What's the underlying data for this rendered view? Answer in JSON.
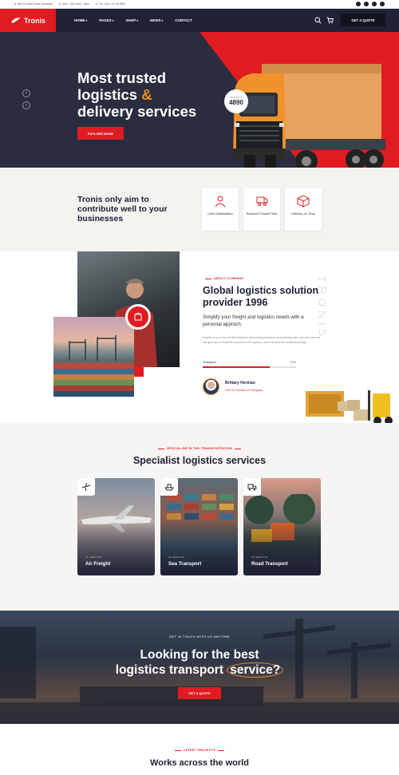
{
  "topbar": {
    "address": "560 St Kilda Road, Australia",
    "hours": "Mon - Sat: 8am - 6pm",
    "phone": "+61 (00) 123 45 6890",
    "social": [
      "facebook-icon",
      "twitter-icon",
      "pinterest-icon",
      "instagram-icon"
    ]
  },
  "nav": {
    "logo": "Tronis",
    "menu": [
      "HOME",
      "PAGES",
      "SHOP",
      "NEWS",
      "CONTACT"
    ],
    "quote": "GET A QUOTE"
  },
  "hero": {
    "title_line1": "Most trusted",
    "title_line2": "logistics",
    "title_amp": "&",
    "title_line3": "delivery services",
    "cta": "EXPLORE MORE",
    "badge_small": "TRUSTED BY",
    "badge_value": "4890",
    "prev": "‹",
    "next": "›"
  },
  "why": {
    "heading": "Tronis only aim to contribute well to your businesses",
    "cards": [
      {
        "label": "Cost Optimisation",
        "icon": "cost-icon"
      },
      {
        "label": "Reduced Transit Time",
        "icon": "transit-icon"
      },
      {
        "label": "Delivery on Time",
        "icon": "box-icon"
      }
    ]
  },
  "about": {
    "tag": "ABOUT COMPANY",
    "title": "Global logistics solution provider 1996",
    "subtitle": "Simplify your freight and logistics needs with a personal approch.",
    "paragraph": "Explain to you how all this mistaken denouncing pleasure and praising pain was born and we will give you a complete account of the system, and expound the actual teachings.",
    "progress_label": "Transport",
    "progress_value": "72%",
    "progress_fraction": 0.72,
    "person": "Brittary Herman",
    "role": "CEO & Founder of Company",
    "vertical": "TRONIS"
  },
  "services": {
    "tag": "SPECIALISE IN THE TRANSPORTATION",
    "title": "Specialist logistics services",
    "cards": [
      {
        "category": "01 SERVICE",
        "name": "Air Freight",
        "icon": "plane-icon"
      },
      {
        "category": "02 SERVICE",
        "name": "Sea Transport",
        "icon": "ship-icon"
      },
      {
        "category": "03 SERVICE",
        "name": "Road Transport",
        "icon": "truck-icon"
      }
    ]
  },
  "cta": {
    "tag": "GET IN TOUCH WITH US ANYTIME",
    "title_line1": "Looking for the best",
    "title_line2": "logistics transport",
    "title_highlight": "service?",
    "button": "GET A QUOTE"
  },
  "projects": {
    "tag": "LATEST PROJECTS",
    "title": "Works across the world"
  },
  "colors": {
    "accent": "#e11b22",
    "dark": "#1f2235",
    "orange": "#f28c1c"
  }
}
